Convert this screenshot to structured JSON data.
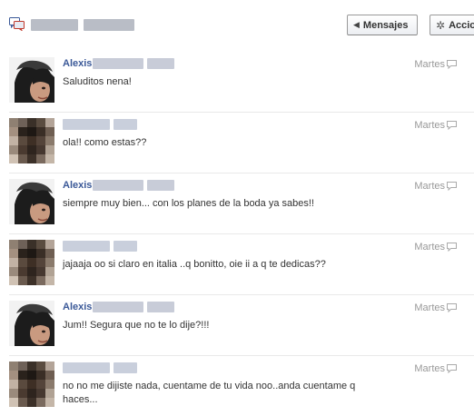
{
  "header": {
    "messages_button": "Mensajes",
    "actions_button": "Acciones"
  },
  "colors": {
    "link_blue": "#3b5998",
    "timestamp_gray": "#999999",
    "separator": "#e9e9e9"
  },
  "messages": [
    {
      "sender": "Alexis",
      "sender_visible": true,
      "avatar": "alexis-avatar",
      "text": "Saluditos nena!",
      "time": "Martes"
    },
    {
      "sender": "",
      "sender_visible": false,
      "avatar": "pixelated-avatar",
      "text": "ola!! como estas??",
      "time": "Martes"
    },
    {
      "sender": "Alexis",
      "sender_visible": true,
      "avatar": "alexis-avatar",
      "text": "siempre muy bien... con los planes de la boda ya sabes!!",
      "time": "Martes"
    },
    {
      "sender": "",
      "sender_visible": false,
      "avatar": "pixelated-avatar",
      "text": "jajaaja oo si claro en italia ..q bonitto, oie ii a q te dedicas??",
      "time": "Martes"
    },
    {
      "sender": "Alexis",
      "sender_visible": true,
      "avatar": "alexis-avatar",
      "text": "Jum!! Segura que no te lo dije?!!!",
      "time": "Martes"
    },
    {
      "sender": "",
      "sender_visible": false,
      "avatar": "pixelated-avatar",
      "text": "no no me dijiste nada, cuentame de tu vida noo..anda cuentame q haces...",
      "time": "Martes"
    }
  ]
}
